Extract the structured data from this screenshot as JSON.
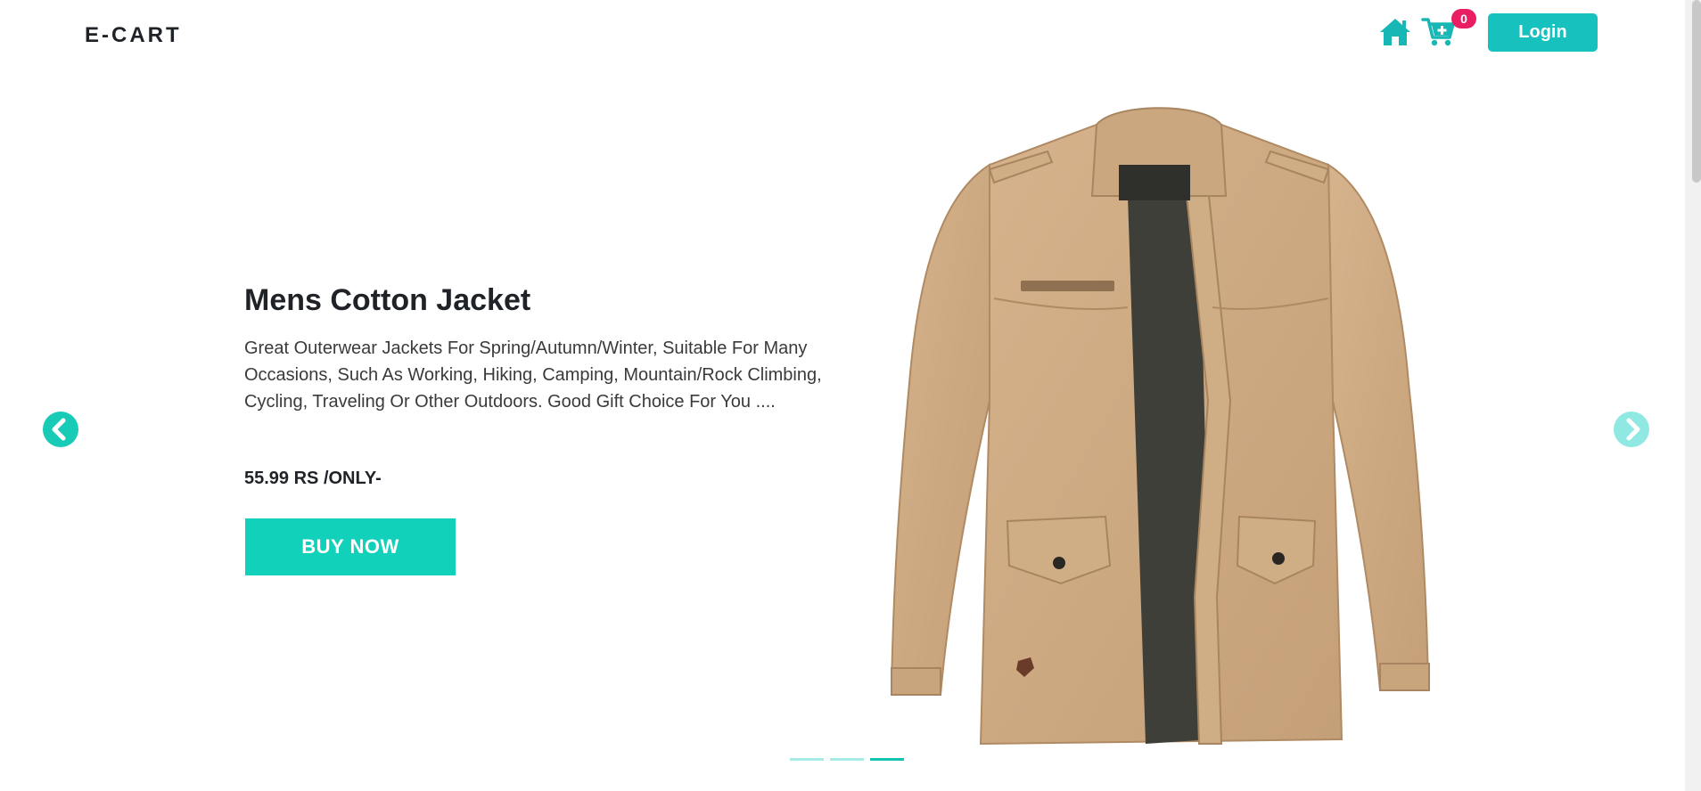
{
  "navbar": {
    "brand": "E-CART",
    "cart_count": "0",
    "login_label": "Login"
  },
  "hero": {
    "title": "Mens Cotton Jacket",
    "description": "Great Outerwear Jackets For Spring/Autumn/Winter, Suitable For Many Occasions, Such As Working, Hiking, Camping, Mountain/Rock Climbing, Cycling, Traveling Or Other Outdoors. Good Gift Choice For You ....",
    "price": "55.99 RS /ONLY-",
    "buy_label": "BUY NOW"
  },
  "carousel": {
    "slide_count": 3,
    "active_index": 2
  },
  "icons": {
    "home": "home-icon",
    "cart": "cart-plus-icon",
    "prev": "chevron-left-circle-icon",
    "next": "chevron-right-circle-icon"
  },
  "colors": {
    "accent": "#17c1bd",
    "button_teal": "#12d1bb",
    "badge": "#e91e63",
    "text_dark": "#1f2328",
    "indicator_active": "#14c2b2",
    "indicator_inactive": "#a6ece6"
  }
}
